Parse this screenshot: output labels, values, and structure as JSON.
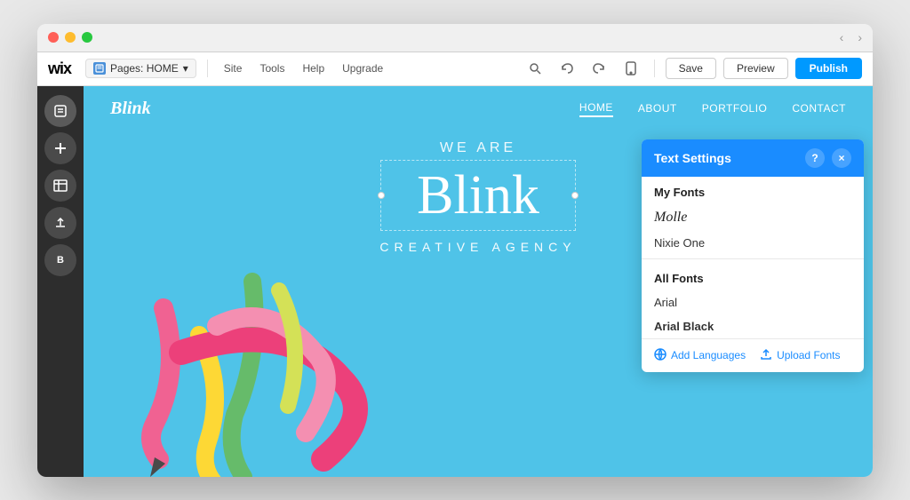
{
  "window": {
    "titlebar": {
      "nav_back": "‹",
      "nav_forward": "›"
    }
  },
  "toolbar": {
    "logo": "wix",
    "pages_label": "Pages: HOME",
    "pages_dropdown_icon": "▾",
    "menu_site": "Site",
    "menu_tools": "Tools",
    "menu_help": "Help",
    "menu_upgrade": "Upgrade",
    "btn_save": "Save",
    "btn_preview": "Preview",
    "btn_publish": "Publish"
  },
  "sidebar": {
    "icons": [
      "⊞",
      "+",
      "☰",
      "↑",
      "B"
    ]
  },
  "canvas": {
    "brand": "Blink",
    "nav": {
      "home": "HOME",
      "about": "ABOUT",
      "portfolio": "PORTFOLIO",
      "contact": "CONTACT"
    },
    "hero_we_are": "WE ARE",
    "hero_blink": "Blink",
    "hero_subtitle": "CREATIVE AGENCY"
  },
  "text_settings_panel": {
    "title": "Text Settings",
    "help_btn": "?",
    "close_btn": "×",
    "my_fonts_header": "My Fonts",
    "font_molle": "Molle",
    "font_nixie": "Nixie One",
    "all_fonts_header": "All Fonts",
    "font_arial": "Arial",
    "font_arial_black": "Arial Black",
    "footer_add_languages": "Add Languages",
    "footer_upload_fonts": "Upload Fonts"
  }
}
